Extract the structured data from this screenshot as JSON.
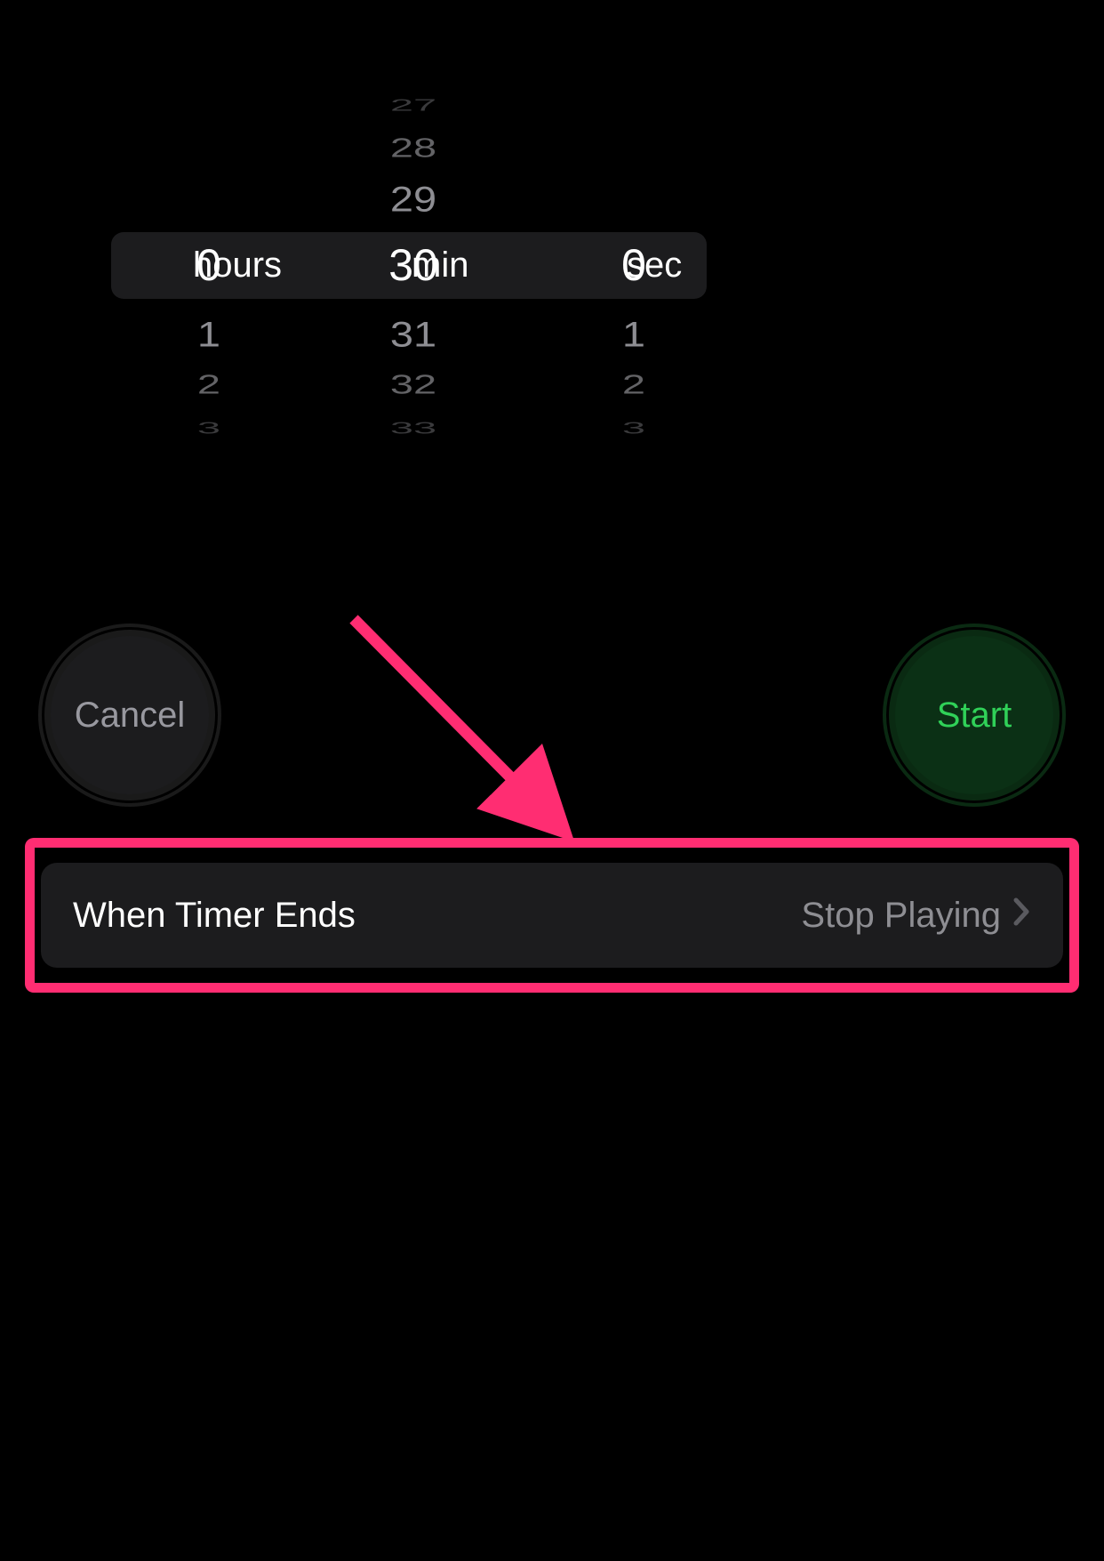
{
  "picker": {
    "hours": {
      "label": "hours",
      "selected": "0",
      "below": [
        "1",
        "2",
        "3"
      ]
    },
    "minutes": {
      "label": "min",
      "selected": "30",
      "above": [
        "27",
        "28",
        "29"
      ],
      "below": [
        "31",
        "32",
        "33"
      ]
    },
    "seconds": {
      "label": "sec",
      "selected": "0",
      "below": [
        "1",
        "2",
        "3"
      ]
    }
  },
  "buttons": {
    "cancel": "Cancel",
    "start": "Start"
  },
  "endAction": {
    "label": "When Timer Ends",
    "value": "Stop Playing"
  },
  "colors": {
    "accent": "#30d158",
    "annotation": "#ff2d72"
  }
}
